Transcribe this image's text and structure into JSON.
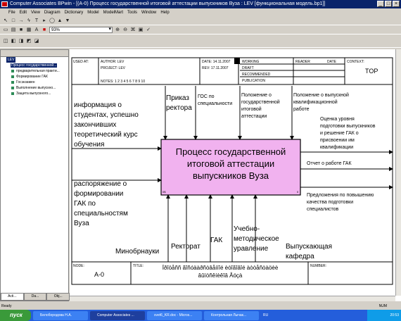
{
  "window": {
    "title": "Computer Associates BPwin - [(A-0) Процесс государственной итоговой аттестации выпускников Вуза : LEV [функциональная модель.bp1]]",
    "controls": [
      "_",
      "□",
      "×"
    ]
  },
  "menu": [
    "File",
    "Edit",
    "View",
    "Diagram",
    "Dictionary",
    "Model",
    "ModelMart",
    "Tools",
    "Window",
    "Help"
  ],
  "toolbar": {
    "zoom_value": "93%"
  },
  "tree": {
    "header": "LEV",
    "selected": "Процесс государственной...",
    "items": [
      "предварительная практи...",
      "Формирование ГАК",
      "Госэкзамен",
      "Выполнение выпускно...",
      "Защита выпускного..."
    ]
  },
  "tabs": [
    "Acti...",
    "Da...",
    "Obj..."
  ],
  "idef0_header": {
    "used_at": "USED AT:",
    "author": "AUTHOR: LEV",
    "project": "PROJECT: LEV",
    "date": "DATE: 14.11.2007",
    "rev": "REV: 17.11.2007",
    "notes": "NOTES: 1 2 3 4 5 6 7 8 9 10",
    "status": [
      "WORKING",
      "DRAFT",
      "RECOMMENDED",
      "PUBLICATION"
    ],
    "reader": "READER",
    "date_col": "DATE",
    "context": "CONTEXT:",
    "top": "TOP"
  },
  "diagram": {
    "box_title": "Процесс государственной итоговой аттестации выпускников Вуза",
    "box_number": "0",
    "box_cost": "0$",
    "inputs": [
      "информация о студентах, успешно закончивших теоретический курс обучения",
      "распоряжение о формировании ГАК по специальностям Вуза"
    ],
    "controls": [
      "Приказ ректора",
      "ГОС по специальности",
      "Положение о государственной итоговой аттестации",
      "Положение о выпускной квалификационной работе"
    ],
    "outputs": [
      "Оценка уровня подготовки выпускников и решение ГАК о присвоении им квалификации",
      "Отчет о работе ГАК",
      "Предложения по повышению качества подготовки специалистов"
    ],
    "mechanisms": [
      "Минобрнауки",
      "Ректорат",
      "ГАК",
      "Учебно-методическое уравление",
      "Выпускающая кафедра"
    ]
  },
  "footer": {
    "node_label": "NODE:",
    "node_value": "A-0",
    "title_label": "TITLE:",
    "title_value": "Ïðîöåññ ãîñóäàðñòâåííîé èòîãîâîé àòòåñòàöèè âûïóñêíèêîâ Âóçà",
    "number_label": "NUMBER:"
  },
  "status": {
    "left": "Ready",
    "right": "NUM"
  },
  "taskbar": {
    "start": "пуск",
    "tasks": [
      "Белобородова Н.А.",
      "Computer Associates ...",
      "svet6_KR.doc - Micros...",
      "Контрольная Лычак..."
    ],
    "lang": "RU",
    "clock": "20:53"
  }
}
